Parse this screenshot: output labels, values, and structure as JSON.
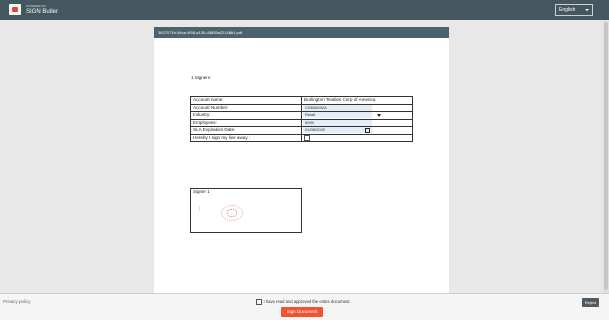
{
  "header": {
    "powered_by": "POWERED BY",
    "app_name": "SIGN Butler",
    "language": "English"
  },
  "document": {
    "filename": "3627071b-94ca-4f95-a135-d3839a22148b1.pdf",
    "signers_text": "1 Signers:",
    "fields": [
      {
        "label": "Account name:",
        "value": "Burlington Textiles Corp of America"
      },
      {
        "label": "Account Number:",
        "value": "CD656092A"
      },
      {
        "label": "Industry:",
        "value": "Retail"
      },
      {
        "label": "Employees:",
        "value": "8999"
      },
      {
        "label": "SLA Expiration Date:",
        "value": "01/08/2020"
      }
    ],
    "consent_label": "Hereby I sign my live away :",
    "signature_box_label": "Signer 1",
    "signature_mark": "|"
  },
  "footer": {
    "privacy_policy": "Privacy policy",
    "agree_text": "I have read and approved the entire document.",
    "reject_label": "Reject",
    "sign_label": "Sign Document"
  },
  "colors": {
    "topbar": "#44565e",
    "doc_header": "#4c626c",
    "sign_button": "#f05433",
    "reject_button": "#4f5b60",
    "input_fill": "#e6ecf8"
  },
  "icons": [
    "logo-icon",
    "chevron-down-icon",
    "calendar-icon",
    "stamp-icon"
  ]
}
